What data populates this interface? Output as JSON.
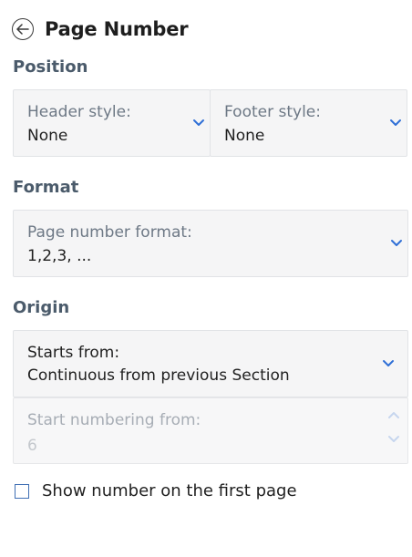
{
  "header": {
    "back_icon": "arrow-left-circle-icon",
    "title": "Page Number"
  },
  "position": {
    "label": "Position",
    "header_style": {
      "label": "Header style:",
      "value": "None"
    },
    "footer_style": {
      "label": "Footer style:",
      "value": "None"
    }
  },
  "format": {
    "label": "Format",
    "page_number_format": {
      "label": "Page number format:",
      "value": "1,2,3, ..."
    }
  },
  "origin": {
    "label": "Origin",
    "starts_from": {
      "label": "Starts from:",
      "value": "Continuous from previous Section"
    },
    "start_numbering_from": {
      "label": "Start numbering from:",
      "value": "6",
      "disabled": true
    }
  },
  "show_first_page": {
    "label": "Show number on the first page",
    "checked": false
  },
  "colors": {
    "accent": "#2f6fd6",
    "section_label": "#4b5b6b",
    "field_bg": "#f5f5f6"
  }
}
